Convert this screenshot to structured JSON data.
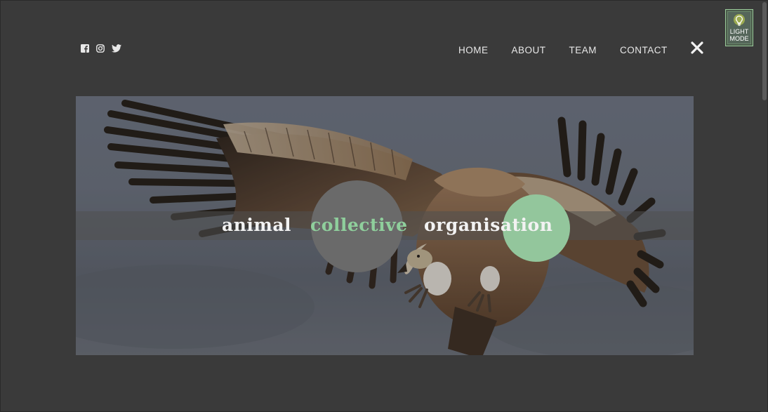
{
  "social": {
    "icons": [
      "facebook-icon",
      "instagram-icon",
      "twitter-icon"
    ]
  },
  "nav": {
    "items": [
      {
        "label": "HOME"
      },
      {
        "label": "ABOUT"
      },
      {
        "label": "TEAM"
      },
      {
        "label": "CONTACT"
      }
    ],
    "close_icon": "close-icon"
  },
  "light_mode": {
    "line1": "LIGHT",
    "line2": "MODE",
    "icon": "lightbulb-icon"
  },
  "hero": {
    "word1": "animal",
    "word2": "collective",
    "word3": "organisation",
    "image": "vulture-in-flight"
  },
  "colors": {
    "background": "#3a3a3a",
    "accent_green": "#93c69c",
    "circle_grey": "#6a6a6a",
    "text": "#f2f2f2"
  }
}
